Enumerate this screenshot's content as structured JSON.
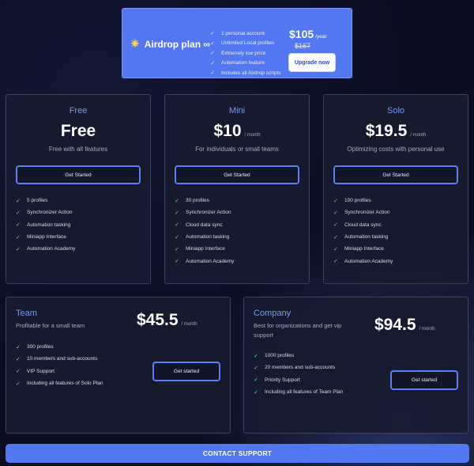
{
  "airdrop": {
    "title": "Airdrop plan ∞",
    "icon": "sparkle-icon",
    "features": [
      "1 personal account",
      "Unlimited Local profiles",
      "Extremely low price",
      "Automation feature",
      "Includes all Airdrop scripts"
    ],
    "price": "$105",
    "period": "/year",
    "old_price": "$167",
    "button": "Upgrade now"
  },
  "plans": [
    {
      "name": "Free",
      "price": "Free",
      "period": "",
      "description": "Free with all features",
      "button": "Get Started",
      "features": [
        "5 profiles",
        "Synchronizer Action",
        "Automation tasking",
        "Miniapp Interface",
        "Automation Academy"
      ]
    },
    {
      "name": "Mini",
      "price": "$10",
      "period": "/ month",
      "description": "For individuals or small teams",
      "button": "Get Started",
      "features": [
        "30 profiles",
        "Synchronizer Action",
        "Cloud data sync",
        "Automation tasking",
        "Miniapp Interface",
        "Automation Academy"
      ]
    },
    {
      "name": "Solo",
      "price": "$19.5",
      "period": "/ month",
      "description": "Optimizing costs with personal use",
      "button": "Get Started",
      "features": [
        "100 profiles",
        "Synchronizer Action",
        "Cloud data sync",
        "Automation tasking",
        "Miniapp Interface",
        "Automation Academy"
      ]
    }
  ],
  "team": {
    "name": "Team",
    "description": "Profitable for a small team",
    "price": "$45.5",
    "period": "/ month",
    "button": "Get started",
    "features": [
      "300 profiles",
      "10 members and sub-accounts",
      "VIP Support",
      "Including all features of Solo Plan"
    ]
  },
  "company": {
    "name": "Company",
    "description": "Best for organizations and get vip support",
    "price": "$94.5",
    "period": "/ month",
    "button": "Get started",
    "features": [
      "1000 profiles",
      "20 members and sub-accounts",
      "Priority Support",
      "Including all features of Team Plan"
    ]
  },
  "contact": {
    "label": "CONTACT SUPPORT"
  },
  "colors": {
    "accent": "#5277f0",
    "check": "#5de0b0",
    "card_bg": "#171b2f",
    "page_bg": "#0b0e1f"
  }
}
